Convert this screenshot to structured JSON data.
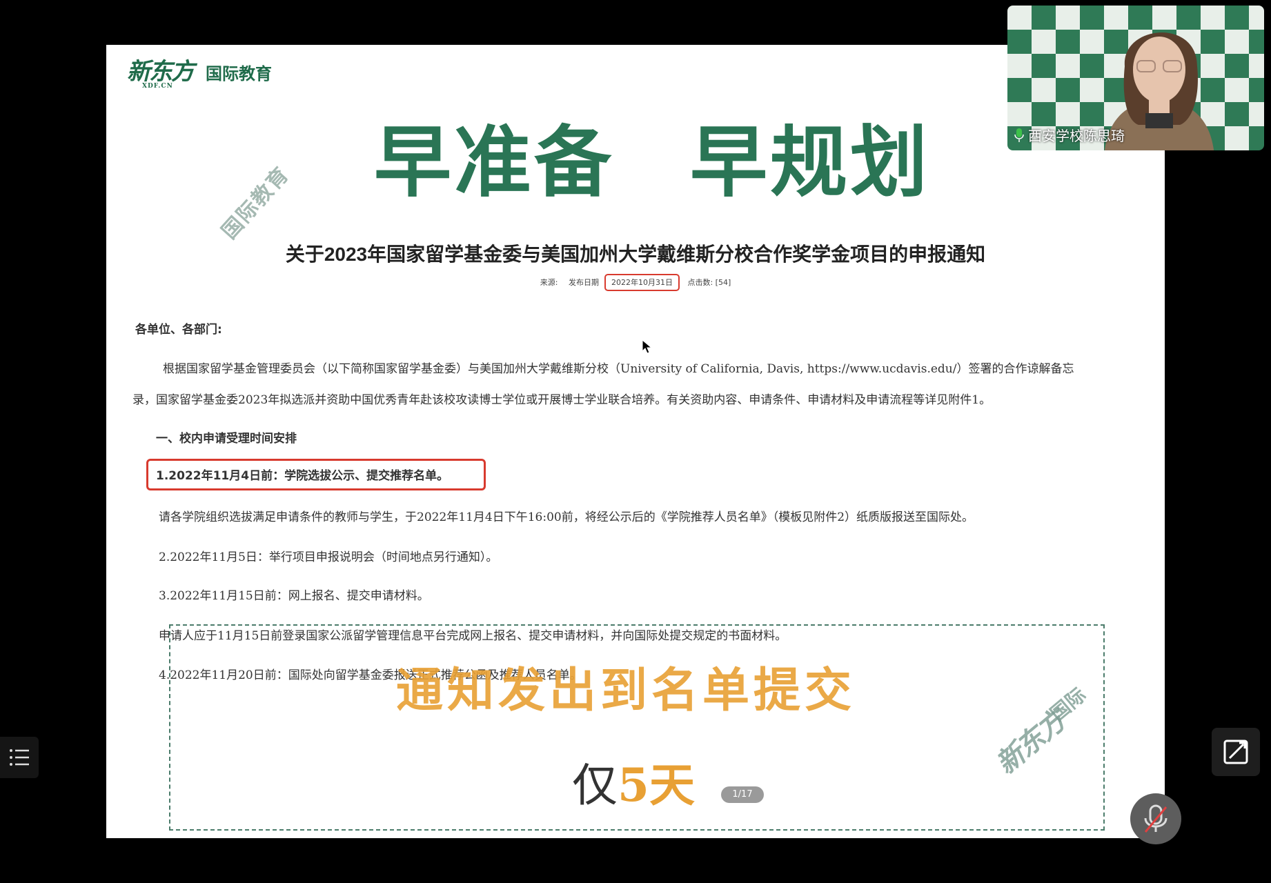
{
  "slide": {
    "logo_mark": "新东方",
    "logo_sub": "XDF.CN",
    "logo_text": "国际教育",
    "watermark_top": "国际教育",
    "headline_left": "早准备",
    "headline_right": "早规划",
    "doc_title": "关于2023年国家留学基金委与美国加州大学戴维斯分校合作奖学金项目的申报通知",
    "meta": {
      "source": "来源:",
      "date_label": "发布日期",
      "date_value": "2022年10月31日",
      "clicks": "点击数: [54]"
    },
    "salutation": "各单位、各部门:",
    "para1_line1": "根据国家留学基金管理委员会（以下简称国家留学基金委）与美国加州大学戴维斯分校（University of California, Davis, https://www.ucdavis.edu/）签署的合作谅解备忘",
    "para1_line2": "录，国家留学基金委2023年拟选派并资助中国优秀青年赴该校攻读博士学位或开展博士学业联合培养。有关资助内容、申请条件、申请材料及申请流程等详见附件1。",
    "section1": "一、校内申请受理时间安排",
    "item1": "1.2022年11月4日前：学院选拔公示、提交推荐名单。",
    "item1_desc": "请各学院组织选拔满足申请条件的教师与学生，于2022年11月4日下午16:00前，将经公示后的《学院推荐人员名单》（模板见附件2）纸质版报送至国际处。",
    "item2": "2.2022年11月5日：举行项目申报说明会（时间地点另行通知）。",
    "item3": "3.2022年11月15日前：网上报名、提交申请材料。",
    "item3_desc": "申请人应于11月15日前登录国家公派留学管理信息平台完成网上报名、提交申请材料，并向国际处提交规定的书面材料。",
    "item4": "4.2022年11月20日前：国际处向留学基金委报送正式推荐公函及推荐人员名单。",
    "overlay_title": "通知发出到名单提交",
    "overlay_only": "仅",
    "overlay_days_num": "5",
    "overlay_days_unit": "天",
    "watermark_br_mark": "新东方",
    "watermark_br_text": "国际",
    "page_indicator": "1/17"
  },
  "video": {
    "participant_name": "西安学校陈思琦"
  },
  "colors": {
    "brand_green": "#2a7555",
    "highlight_red": "#d83a2e",
    "accent_orange": "#e8a034"
  },
  "icons": [
    "list-icon",
    "share-edit-icon",
    "mic-muted-icon",
    "mic-icon",
    "cursor-icon"
  ]
}
